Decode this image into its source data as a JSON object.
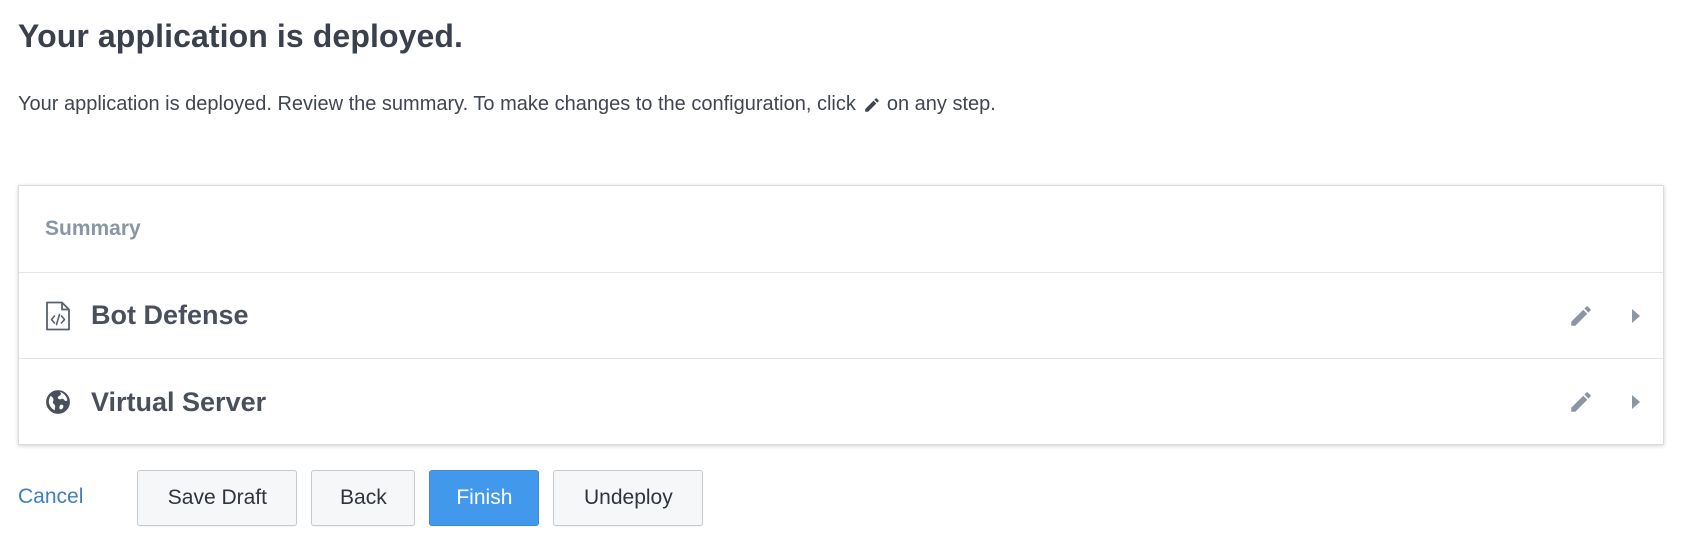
{
  "page": {
    "title": "Your application is deployed.",
    "intro_before": "Your application is deployed. Review the summary. To make changes to the configuration, click",
    "intro_after": "on any step."
  },
  "summary": {
    "header": "Summary",
    "rows": [
      {
        "label": "Bot Defense",
        "icon": "code-file-icon"
      },
      {
        "label": "Virtual Server",
        "icon": "globe-icon"
      }
    ]
  },
  "footer": {
    "cancel_label": "Cancel",
    "save_draft_label": "Save Draft",
    "back_label": "Back",
    "finish_label": "Finish",
    "undeploy_label": "Undeploy"
  },
  "colors": {
    "primary": "#4299eb",
    "link": "#3e7fc1",
    "muted_heading": "#8a96a6",
    "icon_gray": "#8c96a3"
  }
}
